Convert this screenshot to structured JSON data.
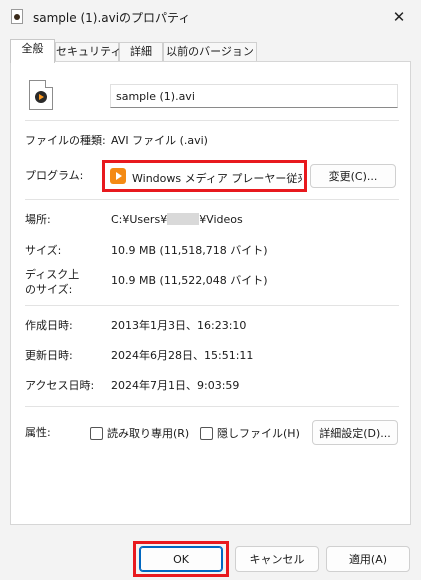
{
  "window": {
    "title": "sample (1).aviのプロパティ",
    "close_glyph": "✕"
  },
  "tabs": [
    {
      "label": "全般",
      "active": true
    },
    {
      "label": "セキュリティ",
      "active": false
    },
    {
      "label": "詳細",
      "active": false
    },
    {
      "label": "以前のバージョン",
      "active": false
    }
  ],
  "general": {
    "file_name": "sample (1).avi",
    "file_type_label": "ファイルの種類:",
    "file_type_value": "AVI ファイル (.avi)",
    "program_label": "プログラム:",
    "program_value": "Windows メディア プレーヤー従来版",
    "change_button": "変更(C)...",
    "location_label": "場所:",
    "location_prefix": "C:¥Users¥",
    "location_suffix": "¥Videos",
    "size_label": "サイズ:",
    "size_value": "10.9 MB (11,518,718 バイト)",
    "disk_size_label_line1": "ディスク上",
    "disk_size_label_line2": "のサイズ:",
    "disk_size_value": "10.9 MB (11,522,048 バイト)",
    "created_label": "作成日時:",
    "created_value": "2013年1月3日、16:23:10",
    "modified_label": "更新日時:",
    "modified_value": "2024年6月28日、15:51:11",
    "accessed_label": "アクセス日時:",
    "accessed_value": "2024年7月1日、9:03:59",
    "attributes_label": "属性:",
    "readonly_label": "読み取り専用(R)",
    "readonly_checked": false,
    "hidden_label": "隠しファイル(H)",
    "hidden_checked": false,
    "advanced_button": "詳細設定(D)..."
  },
  "footer": {
    "ok": "OK",
    "cancel": "キャンセル",
    "apply": "適用(A)"
  },
  "colors": {
    "highlight_outline": "#e8191e",
    "accent": "#0067c0",
    "media_player_orange": "#f48a14"
  }
}
